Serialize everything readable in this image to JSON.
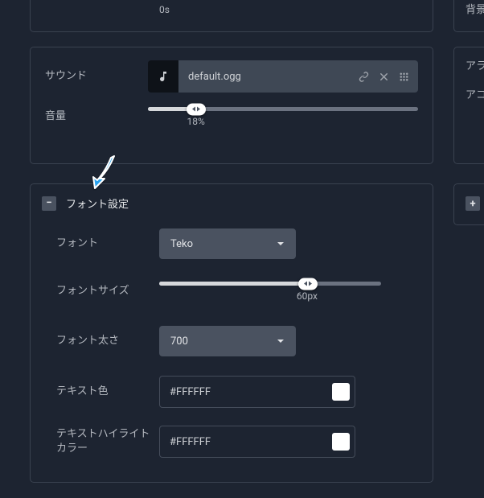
{
  "top_panel": {
    "duration_value": "0s"
  },
  "sound_panel": {
    "sound_label": "サウンド",
    "file_name": "default.ogg",
    "volume_label": "音量",
    "volume_percent": 18,
    "volume_display": "18%"
  },
  "font_panel": {
    "section_title": "フォント設定",
    "collapse_symbol": "−",
    "font_label": "フォント",
    "font_value": "Teko",
    "font_size_label": "フォントサイズ",
    "font_size_percent": 67,
    "font_size_display": "60px",
    "font_weight_label": "フォント太さ",
    "font_weight_value": "700",
    "text_color_label": "テキスト色",
    "text_color_value": "#FFFFFF",
    "highlight_label": "テキストハイライトカラー",
    "highlight_value": "#FFFFFF"
  },
  "right": {
    "bg_label": "背景",
    "alert_label": "アラートメッセージ",
    "acc_label": "アコライドテキスト",
    "plus_symbol": "+"
  }
}
